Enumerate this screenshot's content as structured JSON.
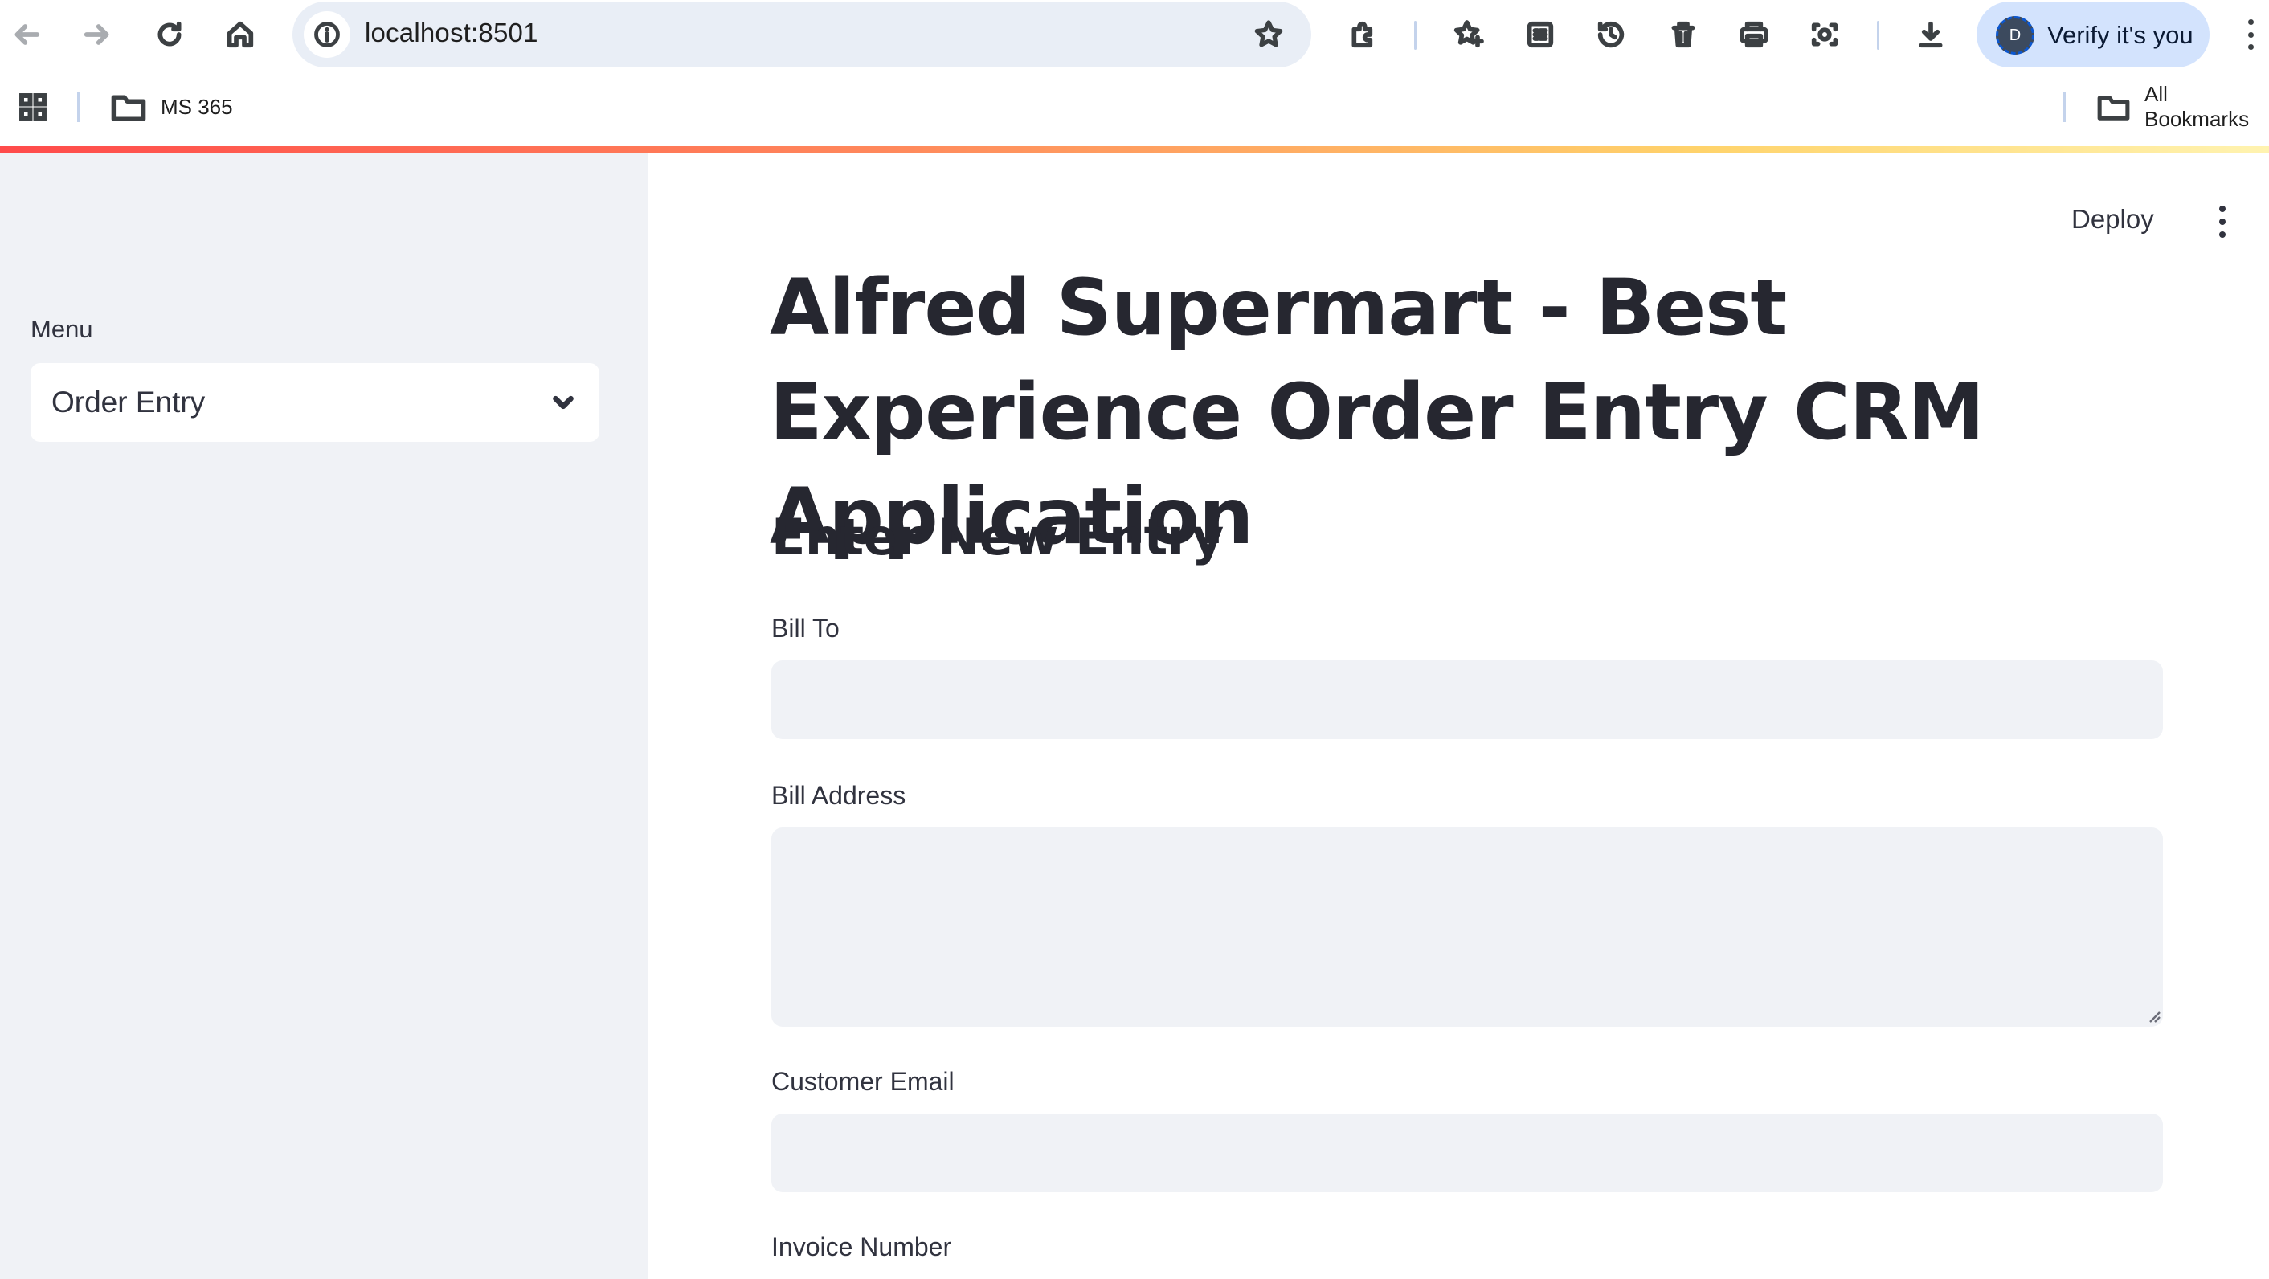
{
  "browser": {
    "url": "localhost:8501",
    "profile_initial": "D",
    "profile_label": "Verify it's you",
    "icons": [
      "back-icon",
      "forward-icon",
      "reload-icon",
      "home-icon",
      "site-info-icon",
      "bookmark-star-icon",
      "extensions-icon",
      "reading-list-star-icon",
      "reader-mode-icon",
      "history-icon",
      "delete-icon",
      "print-icon",
      "screenshot-icon",
      "download-icon",
      "more-vertical-icon"
    ]
  },
  "bookmarks": {
    "items": [
      {
        "label": "MS 365"
      },
      {
        "label": "All Bookmarks"
      }
    ]
  },
  "sidebar": {
    "menu_label": "Menu",
    "selected_option": "Order Entry"
  },
  "header": {
    "deploy_label": "Deploy"
  },
  "main": {
    "title": "Alfred Supermart - Best Experience Order Entry CRM Application",
    "section_title": "Enter New Entry",
    "fields": [
      {
        "label": "Bill To",
        "value": ""
      },
      {
        "label": "Bill Address",
        "value": ""
      },
      {
        "label": "Customer Email",
        "value": ""
      },
      {
        "label": "Invoice Number",
        "value": ""
      }
    ]
  },
  "colors": {
    "sidebar_bg": "#f0f2f6",
    "input_bg": "#f0f2f6",
    "text": "#31333f",
    "omnibox_bg": "#e9eef6",
    "profile_chip_bg": "#d3e3fd"
  }
}
